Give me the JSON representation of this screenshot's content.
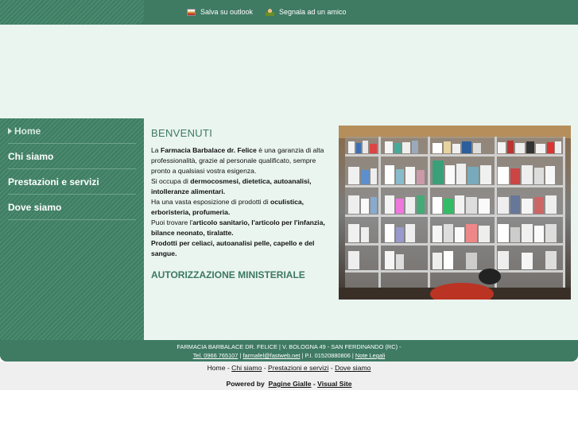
{
  "toolbar": {
    "outlook_label": "Salva su outlook",
    "outlook_icon": "outlook-icon",
    "friend_label": "Segnala ad un amico",
    "friend_icon": "person-icon"
  },
  "sidebar": {
    "items": [
      {
        "label": "Home",
        "active": true
      },
      {
        "label": "Chi siamo"
      },
      {
        "label": "Prestazioni e servizi"
      },
      {
        "label": "Dove siamo"
      }
    ]
  },
  "main": {
    "welcome_title": "BENVENUTI",
    "intro": {
      "p1_a": "La ",
      "p1_b": "Farmacia Barbalace dr. Felice",
      "p1_c": " è una garanzia di alta professionalità, grazie al personale qualificato, sempre pronto a qualsiasi vostra esigenza.",
      "p2_a": "Si occupa di ",
      "p2_b": "dermocosmesi, dietetica, autoanalisi, intolleranze alimentari.",
      "p3_a": "Ha una vasta esposizione di prodotti di ",
      "p3_b": "oculistica, erboristeria, profumeria.",
      "p4_a": "Puoi trovare l'",
      "p4_b": "articolo sanitario, l'articolo per l'infanzia, bilance neonato, tiralatte.",
      "p5": "Prodotti per celiaci, autoanalisi pelle, capello e del sangue."
    },
    "auth_title": "AUTORIZZAZIONE MINISTERIALE"
  },
  "footer": {
    "line1": "FARMACIA BARBALACE DR. FELICE | V. BOLOGNA 49 - SAN FERDINANDO (RC) -",
    "tel": "Tel. 0966 765107",
    "sep1": " | ",
    "email": "farmafel@fastweb.net",
    "piva": " | P.I. 01520880806 | ",
    "legal": "Note Legali"
  },
  "bottom_nav": {
    "home": "Home",
    "sep": " - ",
    "chi": "Chi siamo",
    "prest": "Prestazioni e servizi",
    "dove": "Dove siamo",
    "powered_label": "Powered by",
    "pagine": "Pagine Gialle",
    "dash": " - ",
    "visual": "Visual Site"
  },
  "colors": {
    "primary_green": "#3f7a63",
    "light_bg": "#eaf5f0",
    "title_green": "#3c7862"
  }
}
